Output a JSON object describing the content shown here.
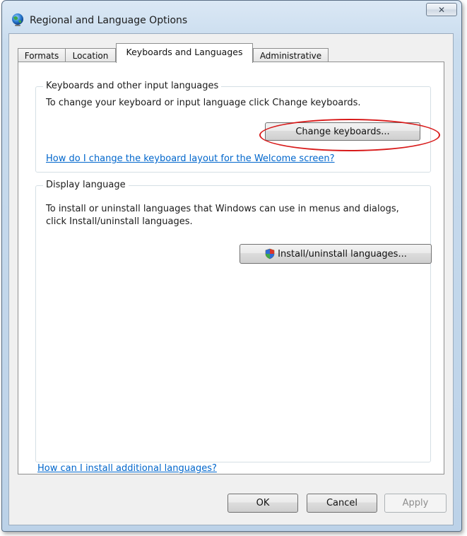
{
  "window": {
    "title": "Regional and Language Options",
    "close_glyph": "✕"
  },
  "tabs": [
    {
      "label": "Formats",
      "active": false
    },
    {
      "label": "Location",
      "active": false
    },
    {
      "label": "Keyboards and Languages",
      "active": true
    },
    {
      "label": "Administrative",
      "active": false
    }
  ],
  "keyboards_group": {
    "legend": "Keyboards and other input languages",
    "description": "To change your keyboard or input language click Change keyboards.",
    "button_label": "Change keyboards...",
    "link": "How do I change the keyboard layout for the Welcome screen?"
  },
  "display_group": {
    "legend": "Display language",
    "description": "To install or uninstall languages that Windows can use in menus and dialogs, click Install/uninstall languages.",
    "button_label": "Install/uninstall languages..."
  },
  "bottom_link": "How can I install additional languages?",
  "footer_buttons": {
    "ok": "OK",
    "cancel": "Cancel",
    "apply": "Apply"
  },
  "colors": {
    "highlight": "#d81b1b",
    "link": "#0066cc"
  }
}
